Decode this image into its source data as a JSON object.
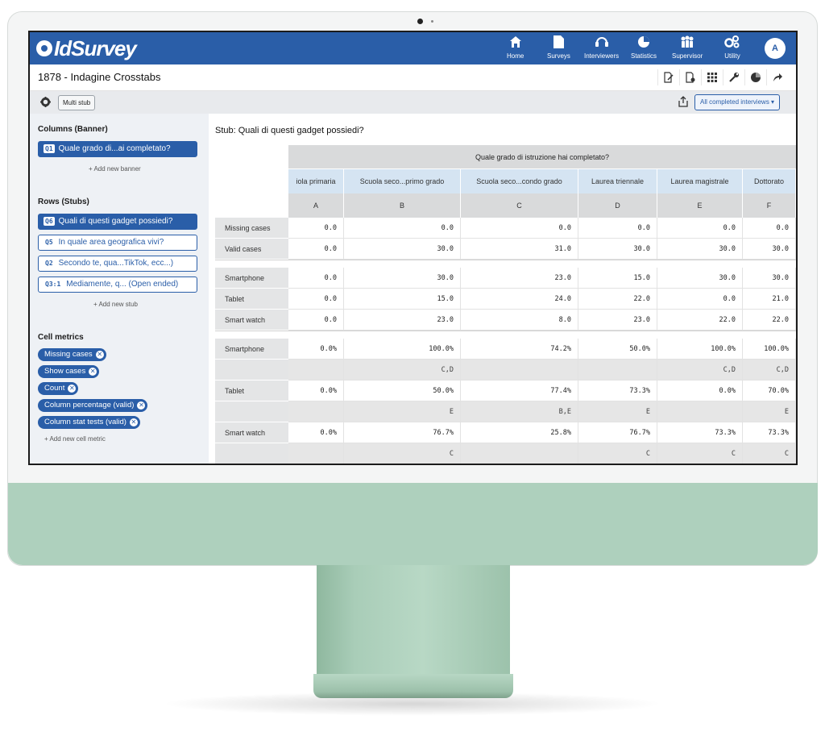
{
  "navbar": {
    "logo": "IdSurvey",
    "items": [
      {
        "label": "Home",
        "icon": "home-icon"
      },
      {
        "label": "Surveys",
        "icon": "document-icon"
      },
      {
        "label": "Interviewers",
        "icon": "headset-icon"
      },
      {
        "label": "Statistics",
        "icon": "pie-chart-icon"
      },
      {
        "label": "Supervisor",
        "icon": "people-icon"
      },
      {
        "label": "Utility",
        "icon": "gears-icon"
      }
    ],
    "avatar": "A"
  },
  "page": {
    "title": "1878 - Indagine Crosstabs"
  },
  "toolbar": {
    "multi_stub": "Multi stub",
    "filter": "All completed interviews ▾"
  },
  "sidebar": {
    "columns_title": "Columns (Banner)",
    "banner": {
      "tag": "Q1",
      "label": "Quale grado di...ai completato?"
    },
    "add_banner": "+ Add new banner",
    "rows_title": "Rows (Stubs)",
    "stubs": [
      {
        "tag": "Q6",
        "label": "Quali di questi gadget possiedi?"
      },
      {
        "tag": "Q5",
        "label": "In quale area geografica vivi?"
      },
      {
        "tag": "Q2",
        "label": "Secondo te, qua...TikTok, ecc...)"
      },
      {
        "tag": "Q3:1",
        "label": "Mediamente, q... (Open ended)"
      }
    ],
    "add_stub": "+ Add new stub",
    "metrics_title": "Cell metrics",
    "metrics": [
      "Missing cases",
      "Show cases",
      "Count",
      "Column percentage (valid)",
      "Column stat tests (valid)"
    ],
    "add_metric": "+ Add new cell metric"
  },
  "table": {
    "stub_title": "Stub: Quali di questi gadget possiedi?",
    "banner_title": "Quale grado di istruzione hai completato?",
    "columns": [
      "iola primaria",
      "Scuola seco...primo grado",
      "Scuola seco...condo grado",
      "Laurea triennale",
      "Laurea magistrale",
      "Dottorato"
    ],
    "letters": [
      "A",
      "B",
      "C",
      "D",
      "E",
      "F"
    ],
    "rows": [
      {
        "label": "Missing cases",
        "values": [
          "0.0",
          "0.0",
          "0.0",
          "0.0",
          "0.0",
          "0.0"
        ]
      },
      {
        "label": "Valid cases",
        "values": [
          "0.0",
          "30.0",
          "31.0",
          "30.0",
          "30.0",
          "30.0"
        ]
      },
      {
        "label": "Smartphone",
        "values": [
          "0.0",
          "30.0",
          "23.0",
          "15.0",
          "30.0",
          "30.0"
        ]
      },
      {
        "label": "Tablet",
        "values": [
          "0.0",
          "15.0",
          "24.0",
          "22.0",
          "0.0",
          "21.0"
        ]
      },
      {
        "label": "Smart watch",
        "values": [
          "0.0",
          "23.0",
          "8.0",
          "23.0",
          "22.0",
          "22.0"
        ]
      },
      {
        "label": "Smartphone",
        "values": [
          "0.0%",
          "100.0%",
          "74.2%",
          "50.0%",
          "100.0%",
          "100.0%"
        ]
      },
      {
        "label": "",
        "values": [
          "",
          "C,D",
          "",
          "",
          "C,D",
          "C,D"
        ]
      },
      {
        "label": "Tablet",
        "values": [
          "0.0%",
          "50.0%",
          "77.4%",
          "73.3%",
          "0.0%",
          "70.0%"
        ]
      },
      {
        "label": "",
        "values": [
          "",
          "E",
          "B,E",
          "E",
          "",
          "E"
        ]
      },
      {
        "label": "Smart watch",
        "values": [
          "0.0%",
          "76.7%",
          "25.8%",
          "76.7%",
          "73.3%",
          "73.3%"
        ]
      },
      {
        "label": "",
        "values": [
          "",
          "C",
          "",
          "C",
          "C",
          "C"
        ]
      }
    ]
  }
}
